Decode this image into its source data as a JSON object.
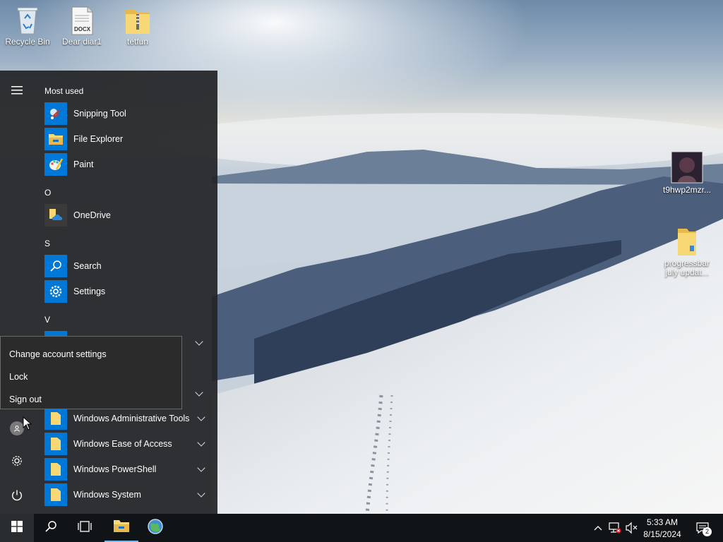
{
  "desktop": {
    "icons": [
      {
        "label": "Recycle Bin",
        "icon": "recycle-bin-icon"
      },
      {
        "label": "Dear diar1",
        "icon": "docx-file-icon",
        "badge": "DOCX"
      },
      {
        "label": "tetfun",
        "icon": "zip-folder-icon"
      },
      {
        "label": "t9hwp2mzr...",
        "icon": "image-file-icon"
      },
      {
        "label": "progressbar july updat...",
        "icon": "folder-icon"
      }
    ]
  },
  "start_menu": {
    "most_used_label": "Most used",
    "most_used": [
      {
        "label": "Snipping Tool",
        "icon": "snipping-tool-icon"
      },
      {
        "label": "File Explorer",
        "icon": "file-explorer-icon"
      },
      {
        "label": "Paint",
        "icon": "paint-icon"
      }
    ],
    "groups": [
      {
        "letter": "O",
        "items": [
          {
            "label": "OneDrive",
            "icon": "onedrive-icon"
          }
        ]
      },
      {
        "letter": "S",
        "items": [
          {
            "label": "Search",
            "icon": "search-icon"
          },
          {
            "label": "Settings",
            "icon": "settings-icon"
          }
        ]
      },
      {
        "letter": "V"
      }
    ],
    "windows_folders": [
      {
        "label": "Windows Administrative Tools",
        "icon": "folder-icon"
      },
      {
        "label": "Windows Ease of Access",
        "icon": "folder-icon"
      },
      {
        "label": "Windows PowerShell",
        "icon": "folder-icon"
      },
      {
        "label": "Windows System",
        "icon": "folder-icon"
      }
    ],
    "rail": {
      "hamburger": "hamburger-menu-icon",
      "account": "user-avatar-icon",
      "settings": "gear-icon",
      "power": "power-icon"
    }
  },
  "account_popup": {
    "items": [
      "Change account settings",
      "Lock",
      "Sign out"
    ]
  },
  "taskbar": {
    "start": "windows-logo-icon",
    "search": "search-icon",
    "task_view": "task-view-icon",
    "file_explorer": "file-explorer-icon",
    "browser": "browser-globe-icon",
    "tray": {
      "chevron": "show-hidden-icons-chevron",
      "network": "network-disconnected-icon",
      "volume": "volume-muted-icon",
      "time": "5:33 AM",
      "date": "8/15/2024",
      "notification_count": "2"
    }
  },
  "colors": {
    "accent": "#0078d7",
    "start_menu_bg": "#222426",
    "taskbar_bg": "#111417",
    "folder_yellow": "#f8d775"
  }
}
